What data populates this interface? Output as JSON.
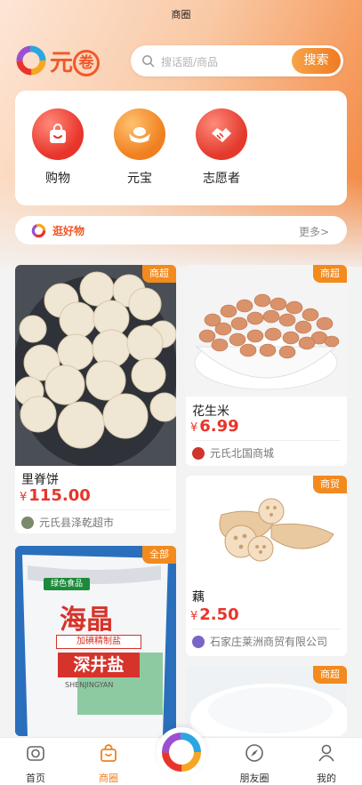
{
  "status_title": "商圈",
  "brand": {
    "name_part1": "元",
    "name_part2": "卷"
  },
  "search": {
    "placeholder": "搜话题/商品",
    "button": "搜索"
  },
  "quick_entries": [
    {
      "label": "购物",
      "icon": "shopping-bag-icon"
    },
    {
      "label": "元宝",
      "icon": "ingot-icon"
    },
    {
      "label": "志愿者",
      "icon": "handshake-icon"
    }
  ],
  "section": {
    "title": "逛好物",
    "more": "更多>"
  },
  "products": [
    {
      "tag": "商超",
      "name": "里脊饼",
      "currency": "¥",
      "price": "115.00",
      "shop": "元氏县泽乾超市"
    },
    {
      "tag": "商超",
      "name": "花生米",
      "currency": "¥",
      "price": "6.99",
      "shop": "元氏北国商城"
    },
    {
      "tag": "商贸",
      "name": "藕",
      "currency": "¥",
      "price": "2.50",
      "shop": "石家庄莱洲商贸有限公司"
    },
    {
      "tag": "全部",
      "salt_brand": "海晶",
      "salt_sub": "加碘精制盐",
      "salt_name": "深井盐",
      "salt_pinyin": "SHENJINGYAN",
      "salt_badge": "绿色食品"
    },
    {
      "tag": "商超"
    }
  ],
  "nav": [
    {
      "label": "首页",
      "icon": "home-icon"
    },
    {
      "label": "商圈",
      "icon": "shop-bag-icon"
    },
    {
      "label": "朋友圈",
      "icon": "compass-icon"
    },
    {
      "label": "我的",
      "icon": "user-icon"
    }
  ],
  "colors": {
    "accent": "#f0592b",
    "price": "#e8352b",
    "tag": "#f28a1e",
    "nav_active": "#f0801f"
  }
}
